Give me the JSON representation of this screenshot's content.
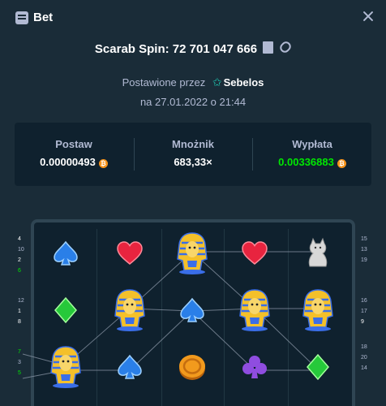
{
  "header": {
    "title": "Bet"
  },
  "game": {
    "text": "Scarab Spin: 72 701 047 666"
  },
  "placed": {
    "prefix": "Postawione przez",
    "user": "Sebelos",
    "date": "na 27.01.2022 o 21:44"
  },
  "stats": {
    "bet_label": "Postaw",
    "bet_value": "0.00000493",
    "multiplier_label": "Mnożnik",
    "multiplier_value": "683,33×",
    "payout_label": "Wypłata",
    "payout_value": "0.00336883",
    "coin_symbol": "₿"
  },
  "paylines_left": [
    "4",
    "10",
    "2",
    "6",
    "12",
    "1",
    "8",
    "7",
    "3",
    "5"
  ],
  "paylines_right": [
    "15",
    "13",
    "19",
    "16",
    "17",
    "9",
    "18",
    "20",
    "14"
  ],
  "reels": [
    [
      "spade",
      "diamond",
      "pharaoh"
    ],
    [
      "heart",
      "pharaoh",
      "spade"
    ],
    [
      "pharaoh",
      "spade",
      "coin"
    ],
    [
      "heart",
      "pharaoh",
      "club"
    ],
    [
      "cat",
      "pharaoh",
      "diamond"
    ]
  ],
  "colors": {
    "payout": "#00e701",
    "accent_star": "#1fcab4"
  }
}
